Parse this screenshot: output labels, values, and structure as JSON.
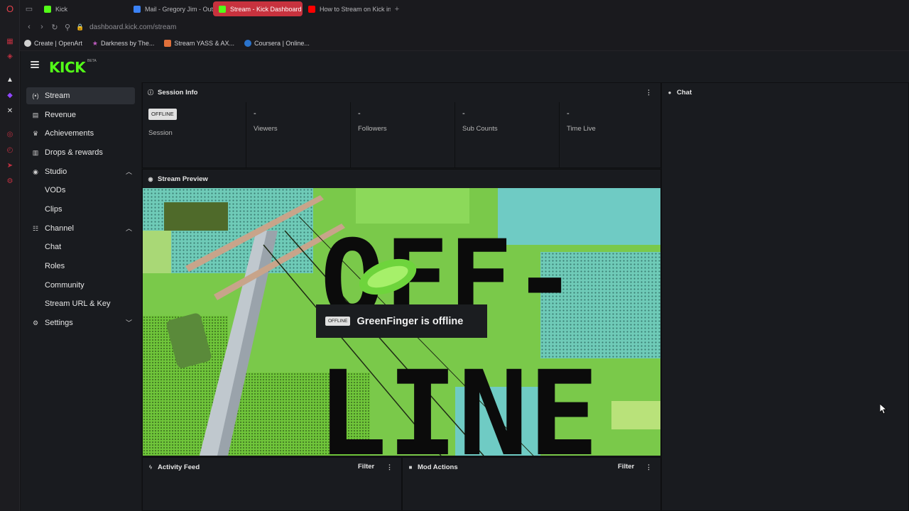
{
  "browser": {
    "tabs": [
      {
        "label": "Kick",
        "favicon_color": "#53fc18",
        "active": false
      },
      {
        "label": "Mail - Gregory Jim - Outl",
        "favicon_color": "#3b82f6",
        "active": false
      },
      {
        "label": "Stream - Kick Dashboard",
        "favicon_color": "#53fc18",
        "active": true
      },
      {
        "label": "How to Stream on Kick in",
        "favicon_color": "#ff0000",
        "active": false
      }
    ],
    "new_tab": "+",
    "url_host": "dashboard.kick.com",
    "url_path": "/stream",
    "bookmarks": [
      {
        "label": "Create | OpenArt",
        "icon_color": "#d0d0d0"
      },
      {
        "label": "Darkness by The...",
        "icon_color": "#c05cc0"
      },
      {
        "label": "Stream YASS & AX...",
        "icon_color": "#e0703a"
      },
      {
        "label": "Coursera | Online...",
        "icon_color": "#2a73cc"
      }
    ]
  },
  "app": {
    "logo": "KICK",
    "logo_badge": "BETA",
    "brand_color": "#53fc18"
  },
  "sidebar": {
    "items": [
      {
        "label": "Stream",
        "icon": "broadcast-icon",
        "glyph": "(•)",
        "active": true
      },
      {
        "label": "Revenue",
        "icon": "revenue-icon",
        "glyph": "▤"
      },
      {
        "label": "Achievements",
        "icon": "trophy-icon",
        "glyph": "♛"
      },
      {
        "label": "Drops & rewards",
        "icon": "layers-icon",
        "glyph": "▥"
      },
      {
        "label": "Studio",
        "icon": "studio-icon",
        "glyph": "◉",
        "expanded": true
      },
      {
        "label": "VODs",
        "sub": true
      },
      {
        "label": "Clips",
        "sub": true
      },
      {
        "label": "Channel",
        "icon": "people-icon",
        "glyph": "☷",
        "expanded": true
      },
      {
        "label": "Chat",
        "sub": true
      },
      {
        "label": "Roles",
        "sub": true
      },
      {
        "label": "Community",
        "sub": true
      },
      {
        "label": "Stream URL & Key",
        "sub": true
      },
      {
        "label": "Settings",
        "icon": "gear-icon",
        "glyph": "⚙",
        "expanded": false
      }
    ]
  },
  "session_info": {
    "title": "Session Info",
    "status_badge": "OFFLINE",
    "session_label": "Session",
    "stats": [
      {
        "value": "-",
        "label": "Viewers"
      },
      {
        "value": "-",
        "label": "Followers"
      },
      {
        "value": "-",
        "label": "Sub Counts"
      },
      {
        "value": "-",
        "label": "Time Live"
      }
    ]
  },
  "chat": {
    "title": "Chat"
  },
  "stream_preview": {
    "title": "Stream Preview",
    "offline_badge": "OFFLINE",
    "offline_message": "GreenFinger is offline",
    "art_text_top": "OFF-",
    "art_text_bottom": "LINE"
  },
  "activity_feed": {
    "title": "Activity Feed",
    "filter": "Filter"
  },
  "mod_actions": {
    "title": "Mod Actions",
    "filter": "Filter"
  }
}
